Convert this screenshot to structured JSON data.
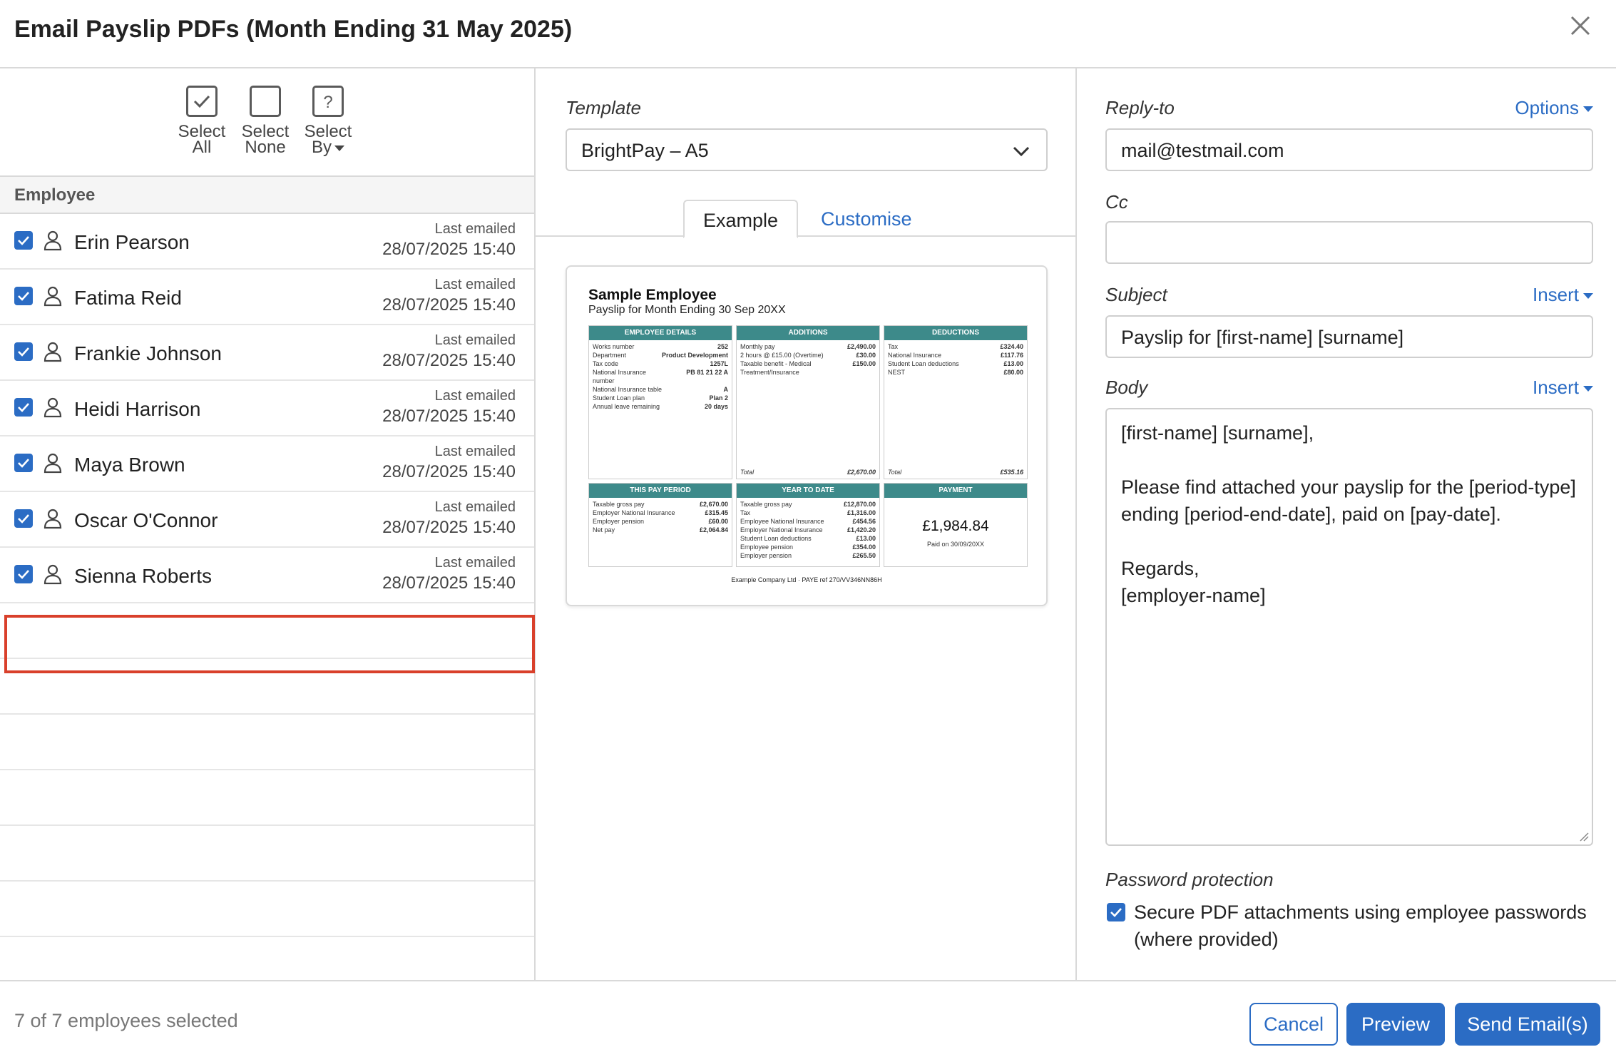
{
  "dialog": {
    "title": "Email Payslip PDFs (Month Ending 31 May 2025)"
  },
  "select_toolbar": {
    "select_all_line1": "Select",
    "select_all_line2": "All",
    "select_none_line1": "Select",
    "select_none_line2": "None",
    "select_by_line1": "Select",
    "select_by_line2": "By"
  },
  "employee_list": {
    "header": "Employee",
    "last_emailed_label": "Last emailed",
    "rows": [
      {
        "name": "Erin Pearson",
        "last_emailed": "28/07/2025 15:40",
        "checked": true
      },
      {
        "name": "Fatima Reid",
        "last_emailed": "28/07/2025 15:40",
        "checked": true
      },
      {
        "name": "Frankie Johnson",
        "last_emailed": "28/07/2025 15:40",
        "checked": true
      },
      {
        "name": "Heidi Harrison",
        "last_emailed": "28/07/2025 15:40",
        "checked": true
      },
      {
        "name": "Maya Brown",
        "last_emailed": "28/07/2025 15:40",
        "checked": true
      },
      {
        "name": "Oscar O'Connor",
        "last_emailed": "28/07/2025 15:40",
        "checked": true
      },
      {
        "name": "Sienna Roberts",
        "last_emailed": "28/07/2025 15:40",
        "checked": true
      }
    ]
  },
  "template": {
    "label": "Template",
    "selected": "BrightPay – A5",
    "tabs": {
      "example": "Example",
      "customise": "Customise"
    }
  },
  "payslip_preview": {
    "employee_name": "Sample Employee",
    "subtitle": "Payslip for Month Ending 30 Sep 20XX",
    "employee_details": {
      "heading": "EMPLOYEE DETAILS",
      "lines": [
        {
          "k": "Works number",
          "v": "252"
        },
        {
          "k": "Department",
          "v": "Product Development"
        },
        {
          "k": "Tax code",
          "v": "1257L"
        },
        {
          "k": "National Insurance",
          "v": "PB 81 21 22 A"
        },
        {
          "k": "number",
          "v": ""
        },
        {
          "k": "National Insurance table",
          "v": "A"
        },
        {
          "k": "Student Loan plan",
          "v": "Plan 2"
        },
        {
          "k": "Annual leave remaining",
          "v": "20 days"
        }
      ]
    },
    "additions": {
      "heading": "ADDITIONS",
      "lines": [
        {
          "k": "Monthly pay",
          "v": "£2,490.00"
        },
        {
          "k": "2 hours @ £15.00 (Overtime)",
          "v": "£30.00"
        },
        {
          "k": "Taxable benefit - Medical",
          "v": "£150.00"
        },
        {
          "k": "Treatment/Insurance",
          "v": ""
        }
      ],
      "total_label": "Total",
      "total": "£2,670.00"
    },
    "deductions": {
      "heading": "DEDUCTIONS",
      "lines": [
        {
          "k": "Tax",
          "v": "£324.40"
        },
        {
          "k": "National Insurance",
          "v": "£117.76"
        },
        {
          "k": "Student Loan deductions",
          "v": "£13.00"
        },
        {
          "k": "NEST",
          "v": "£80.00"
        }
      ],
      "total_label": "Total",
      "total": "£535.16"
    },
    "this_pay_period": {
      "heading": "THIS PAY PERIOD",
      "lines": [
        {
          "k": "Taxable gross pay",
          "v": "£2,670.00"
        },
        {
          "k": "Employer National Insurance",
          "v": "£315.45"
        },
        {
          "k": "Employer pension",
          "v": "£60.00"
        },
        {
          "k": "Net pay",
          "v": "£2,064.84"
        }
      ]
    },
    "year_to_date": {
      "heading": "YEAR TO DATE",
      "lines": [
        {
          "k": "Taxable gross pay",
          "v": "£12,870.00"
        },
        {
          "k": "Tax",
          "v": "£1,316.00"
        },
        {
          "k": "Employee National Insurance",
          "v": "£454.56"
        },
        {
          "k": "Employer National Insurance",
          "v": "£1,420.20"
        },
        {
          "k": "Student Loan deductions",
          "v": "£13.00"
        },
        {
          "k": "Employee pension",
          "v": "£354.00"
        },
        {
          "k": "Employer pension",
          "v": "£265.50"
        }
      ]
    },
    "payment": {
      "heading": "PAYMENT",
      "amount": "£1,984.84",
      "paid_on": "Paid on 30/09/20XX"
    },
    "footer": "Example Company Ltd  ·  PAYE ref 270/VV346NN86H"
  },
  "email": {
    "reply_to_label": "Reply-to",
    "options_label": "Options",
    "reply_to_value": "mail@testmail.com",
    "cc_label": "Cc",
    "cc_value": "",
    "subject_label": "Subject",
    "insert_label": "Insert",
    "subject_value": "Payslip for [first-name] [surname]",
    "body_label": "Body",
    "body_value": "[first-name] [surname],\n\nPlease find attached your payslip for the [period-type] ending [period-end-date], paid on [pay-date].\n\nRegards,\n[employer-name]",
    "password_label": "Password protection",
    "password_text": "Secure PDF attachments using employee passwords (where provided)",
    "password_checked": true
  },
  "footer": {
    "status": "7 of 7 employees selected",
    "cancel": "Cancel",
    "preview": "Preview",
    "send": "Send Email(s)"
  },
  "colors": {
    "accent": "#2b6cc4",
    "highlight": "#d9402b",
    "payslip_header": "#3d8a8a"
  }
}
